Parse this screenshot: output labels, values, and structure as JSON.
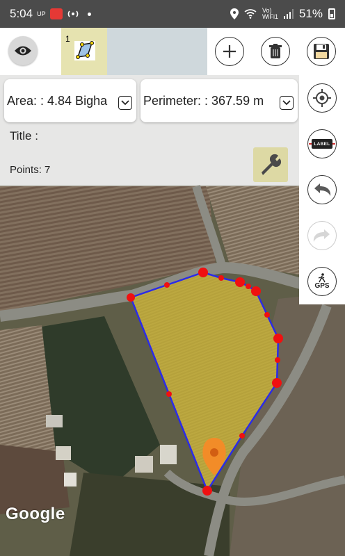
{
  "status_bar": {
    "time": "5:04",
    "carrier_tag": "UP",
    "volte_label": "Vo)\nWiFi1",
    "battery": "51%"
  },
  "toolbar": {
    "tab_number": "1",
    "icons": [
      "eye-icon",
      "polygon-icon",
      "plus-icon",
      "trash-icon",
      "save-icon"
    ]
  },
  "info": {
    "area_text": "Area: : 4.84 Bigha",
    "perimeter_text": "Perimeter: : 367.59 m",
    "title_text": "Title :",
    "points_text": "Points: 7"
  },
  "side": {
    "label_text": "LABEL",
    "gps_text": "GPS",
    "icons": [
      "crosshair-icon",
      "label-icon",
      "undo-icon",
      "redo-icon",
      "gps-walk-icon"
    ]
  },
  "map": {
    "attribution": "Google",
    "polygon_color": "#2b2be8",
    "fill_color": "#d9b43a",
    "vertex_color": "#f01010",
    "marker_color": "#f28c28"
  }
}
